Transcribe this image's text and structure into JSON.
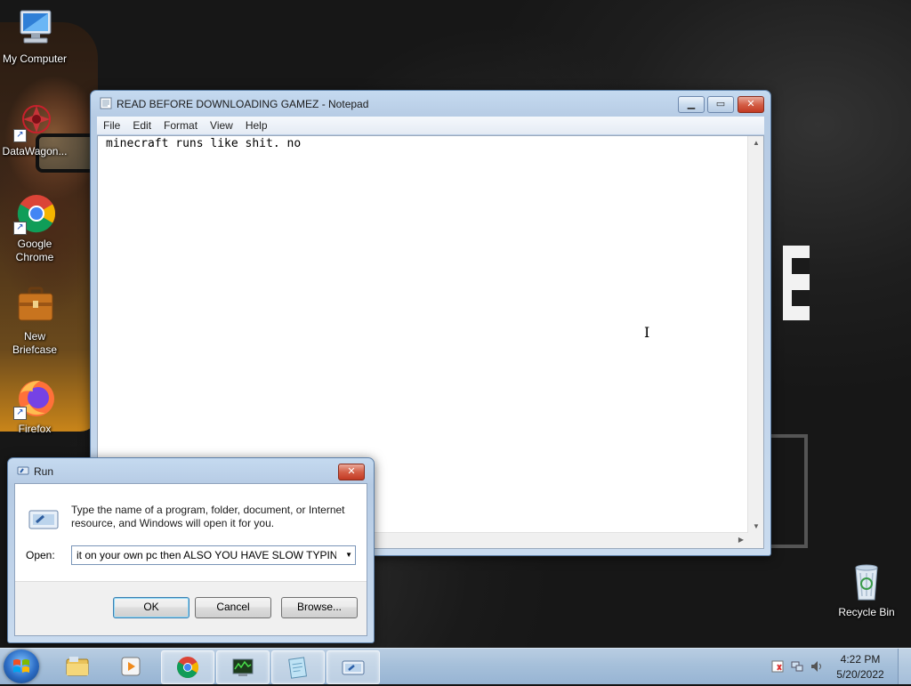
{
  "desktop": {
    "icons": [
      {
        "label": "My Computer",
        "icon": "computer-icon"
      },
      {
        "label": "DataWagon...",
        "icon": "datawagon-icon"
      },
      {
        "label": "Google Chrome",
        "icon": "chrome-icon"
      },
      {
        "label": "New Briefcase",
        "icon": "briefcase-icon"
      },
      {
        "label": "Firefox",
        "icon": "firefox-icon"
      },
      {
        "label": "Recycle Bin",
        "icon": "recycle-bin-icon"
      }
    ]
  },
  "notepad": {
    "title": "READ BEFORE DOWNLOADING GAMEZ - Notepad",
    "menu": [
      "File",
      "Edit",
      "Format",
      "View",
      "Help"
    ],
    "content": "minecraft runs like shit. no",
    "colors": {
      "selection": "#ffffff"
    }
  },
  "run": {
    "title": "Run",
    "description": "Type the name of a program, folder, document, or Internet resource, and Windows will open it for you.",
    "open_label": "Open:",
    "open_value": "it on your own pc then ALSO YOU HAVE SLOW TYPING",
    "ok_label": "OK",
    "cancel_label": "Cancel",
    "browse_label": "Browse..."
  },
  "taskbar": {
    "pinned": [
      "explorer-icon",
      "media-player-icon",
      "chrome-icon",
      "task-manager-icon",
      "notepad-icon",
      "run-icon"
    ],
    "clock_time": "4:22 PM",
    "clock_date": "5/20/2022",
    "tray": [
      "action-center-icon",
      "network-icon",
      "volume-icon"
    ]
  }
}
